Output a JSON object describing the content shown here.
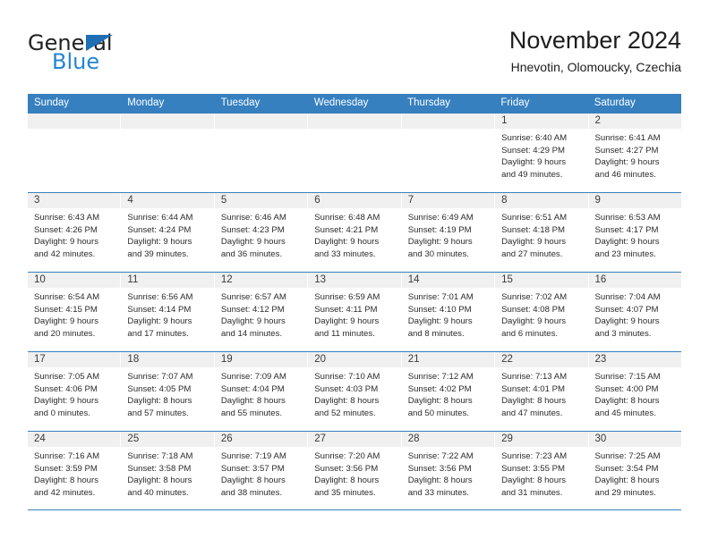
{
  "brand": {
    "name_part1": "General",
    "name_part2": "Blue",
    "accent_color": "#2585d3",
    "triangle_color": "#1f6fb5"
  },
  "header": {
    "title": "November 2024",
    "subtitle": "Hnevotin, Olomoucky, Czechia"
  },
  "calendar": {
    "header_bg": "#3680c0",
    "daynum_bg": "#f0f0f0",
    "weekdays": [
      "Sunday",
      "Monday",
      "Tuesday",
      "Wednesday",
      "Thursday",
      "Friday",
      "Saturday"
    ],
    "weeks": [
      [
        {
          "day": "",
          "info": ""
        },
        {
          "day": "",
          "info": ""
        },
        {
          "day": "",
          "info": ""
        },
        {
          "day": "",
          "info": ""
        },
        {
          "day": "",
          "info": ""
        },
        {
          "day": "1",
          "info": "Sunrise: 6:40 AM\nSunset: 4:29 PM\nDaylight: 9 hours\nand 49 minutes."
        },
        {
          "day": "2",
          "info": "Sunrise: 6:41 AM\nSunset: 4:27 PM\nDaylight: 9 hours\nand 46 minutes."
        }
      ],
      [
        {
          "day": "3",
          "info": "Sunrise: 6:43 AM\nSunset: 4:26 PM\nDaylight: 9 hours\nand 42 minutes."
        },
        {
          "day": "4",
          "info": "Sunrise: 6:44 AM\nSunset: 4:24 PM\nDaylight: 9 hours\nand 39 minutes."
        },
        {
          "day": "5",
          "info": "Sunrise: 6:46 AM\nSunset: 4:23 PM\nDaylight: 9 hours\nand 36 minutes."
        },
        {
          "day": "6",
          "info": "Sunrise: 6:48 AM\nSunset: 4:21 PM\nDaylight: 9 hours\nand 33 minutes."
        },
        {
          "day": "7",
          "info": "Sunrise: 6:49 AM\nSunset: 4:19 PM\nDaylight: 9 hours\nand 30 minutes."
        },
        {
          "day": "8",
          "info": "Sunrise: 6:51 AM\nSunset: 4:18 PM\nDaylight: 9 hours\nand 27 minutes."
        },
        {
          "day": "9",
          "info": "Sunrise: 6:53 AM\nSunset: 4:17 PM\nDaylight: 9 hours\nand 23 minutes."
        }
      ],
      [
        {
          "day": "10",
          "info": "Sunrise: 6:54 AM\nSunset: 4:15 PM\nDaylight: 9 hours\nand 20 minutes."
        },
        {
          "day": "11",
          "info": "Sunrise: 6:56 AM\nSunset: 4:14 PM\nDaylight: 9 hours\nand 17 minutes."
        },
        {
          "day": "12",
          "info": "Sunrise: 6:57 AM\nSunset: 4:12 PM\nDaylight: 9 hours\nand 14 minutes."
        },
        {
          "day": "13",
          "info": "Sunrise: 6:59 AM\nSunset: 4:11 PM\nDaylight: 9 hours\nand 11 minutes."
        },
        {
          "day": "14",
          "info": "Sunrise: 7:01 AM\nSunset: 4:10 PM\nDaylight: 9 hours\nand 8 minutes."
        },
        {
          "day": "15",
          "info": "Sunrise: 7:02 AM\nSunset: 4:08 PM\nDaylight: 9 hours\nand 6 minutes."
        },
        {
          "day": "16",
          "info": "Sunrise: 7:04 AM\nSunset: 4:07 PM\nDaylight: 9 hours\nand 3 minutes."
        }
      ],
      [
        {
          "day": "17",
          "info": "Sunrise: 7:05 AM\nSunset: 4:06 PM\nDaylight: 9 hours\nand 0 minutes."
        },
        {
          "day": "18",
          "info": "Sunrise: 7:07 AM\nSunset: 4:05 PM\nDaylight: 8 hours\nand 57 minutes."
        },
        {
          "day": "19",
          "info": "Sunrise: 7:09 AM\nSunset: 4:04 PM\nDaylight: 8 hours\nand 55 minutes."
        },
        {
          "day": "20",
          "info": "Sunrise: 7:10 AM\nSunset: 4:03 PM\nDaylight: 8 hours\nand 52 minutes."
        },
        {
          "day": "21",
          "info": "Sunrise: 7:12 AM\nSunset: 4:02 PM\nDaylight: 8 hours\nand 50 minutes."
        },
        {
          "day": "22",
          "info": "Sunrise: 7:13 AM\nSunset: 4:01 PM\nDaylight: 8 hours\nand 47 minutes."
        },
        {
          "day": "23",
          "info": "Sunrise: 7:15 AM\nSunset: 4:00 PM\nDaylight: 8 hours\nand 45 minutes."
        }
      ],
      [
        {
          "day": "24",
          "info": "Sunrise: 7:16 AM\nSunset: 3:59 PM\nDaylight: 8 hours\nand 42 minutes."
        },
        {
          "day": "25",
          "info": "Sunrise: 7:18 AM\nSunset: 3:58 PM\nDaylight: 8 hours\nand 40 minutes."
        },
        {
          "day": "26",
          "info": "Sunrise: 7:19 AM\nSunset: 3:57 PM\nDaylight: 8 hours\nand 38 minutes."
        },
        {
          "day": "27",
          "info": "Sunrise: 7:20 AM\nSunset: 3:56 PM\nDaylight: 8 hours\nand 35 minutes."
        },
        {
          "day": "28",
          "info": "Sunrise: 7:22 AM\nSunset: 3:56 PM\nDaylight: 8 hours\nand 33 minutes."
        },
        {
          "day": "29",
          "info": "Sunrise: 7:23 AM\nSunset: 3:55 PM\nDaylight: 8 hours\nand 31 minutes."
        },
        {
          "day": "30",
          "info": "Sunrise: 7:25 AM\nSunset: 3:54 PM\nDaylight: 8 hours\nand 29 minutes."
        }
      ]
    ]
  }
}
